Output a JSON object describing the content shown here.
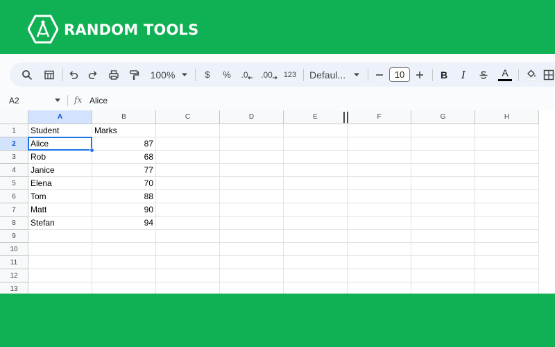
{
  "brand": {
    "name": "RANDOM TOOLS",
    "logo_icon": "compass-icon",
    "color": "#0fb154"
  },
  "toolbar": {
    "zoom": "100%",
    "currency": "$",
    "percent": "%",
    "dec_decrease": ".0",
    "dec_increase": ".00",
    "number_format": "123",
    "font_name": "Defaul...",
    "font_size": "10",
    "bold": "B",
    "italic": "I",
    "text_color_letter": "A"
  },
  "formula_bar": {
    "name_box": "A2",
    "fx": "fx",
    "value": "Alice"
  },
  "columns": [
    "A",
    "B",
    "C",
    "D",
    "E",
    "F",
    "G",
    "H"
  ],
  "rows": [
    "1",
    "2",
    "3",
    "4",
    "5",
    "6",
    "7",
    "8",
    "9",
    "10",
    "11",
    "12",
    "13"
  ],
  "cells": [
    [
      "Student",
      "Marks"
    ],
    [
      "Alice",
      "87"
    ],
    [
      "Rob",
      "68"
    ],
    [
      "Janice",
      "77"
    ],
    [
      "Elena",
      "70"
    ],
    [
      "Tom",
      "88"
    ],
    [
      "Matt",
      "90"
    ],
    [
      "Stefan",
      "94"
    ]
  ],
  "selected_cell": "A2",
  "accent_color": "#1a73e8"
}
